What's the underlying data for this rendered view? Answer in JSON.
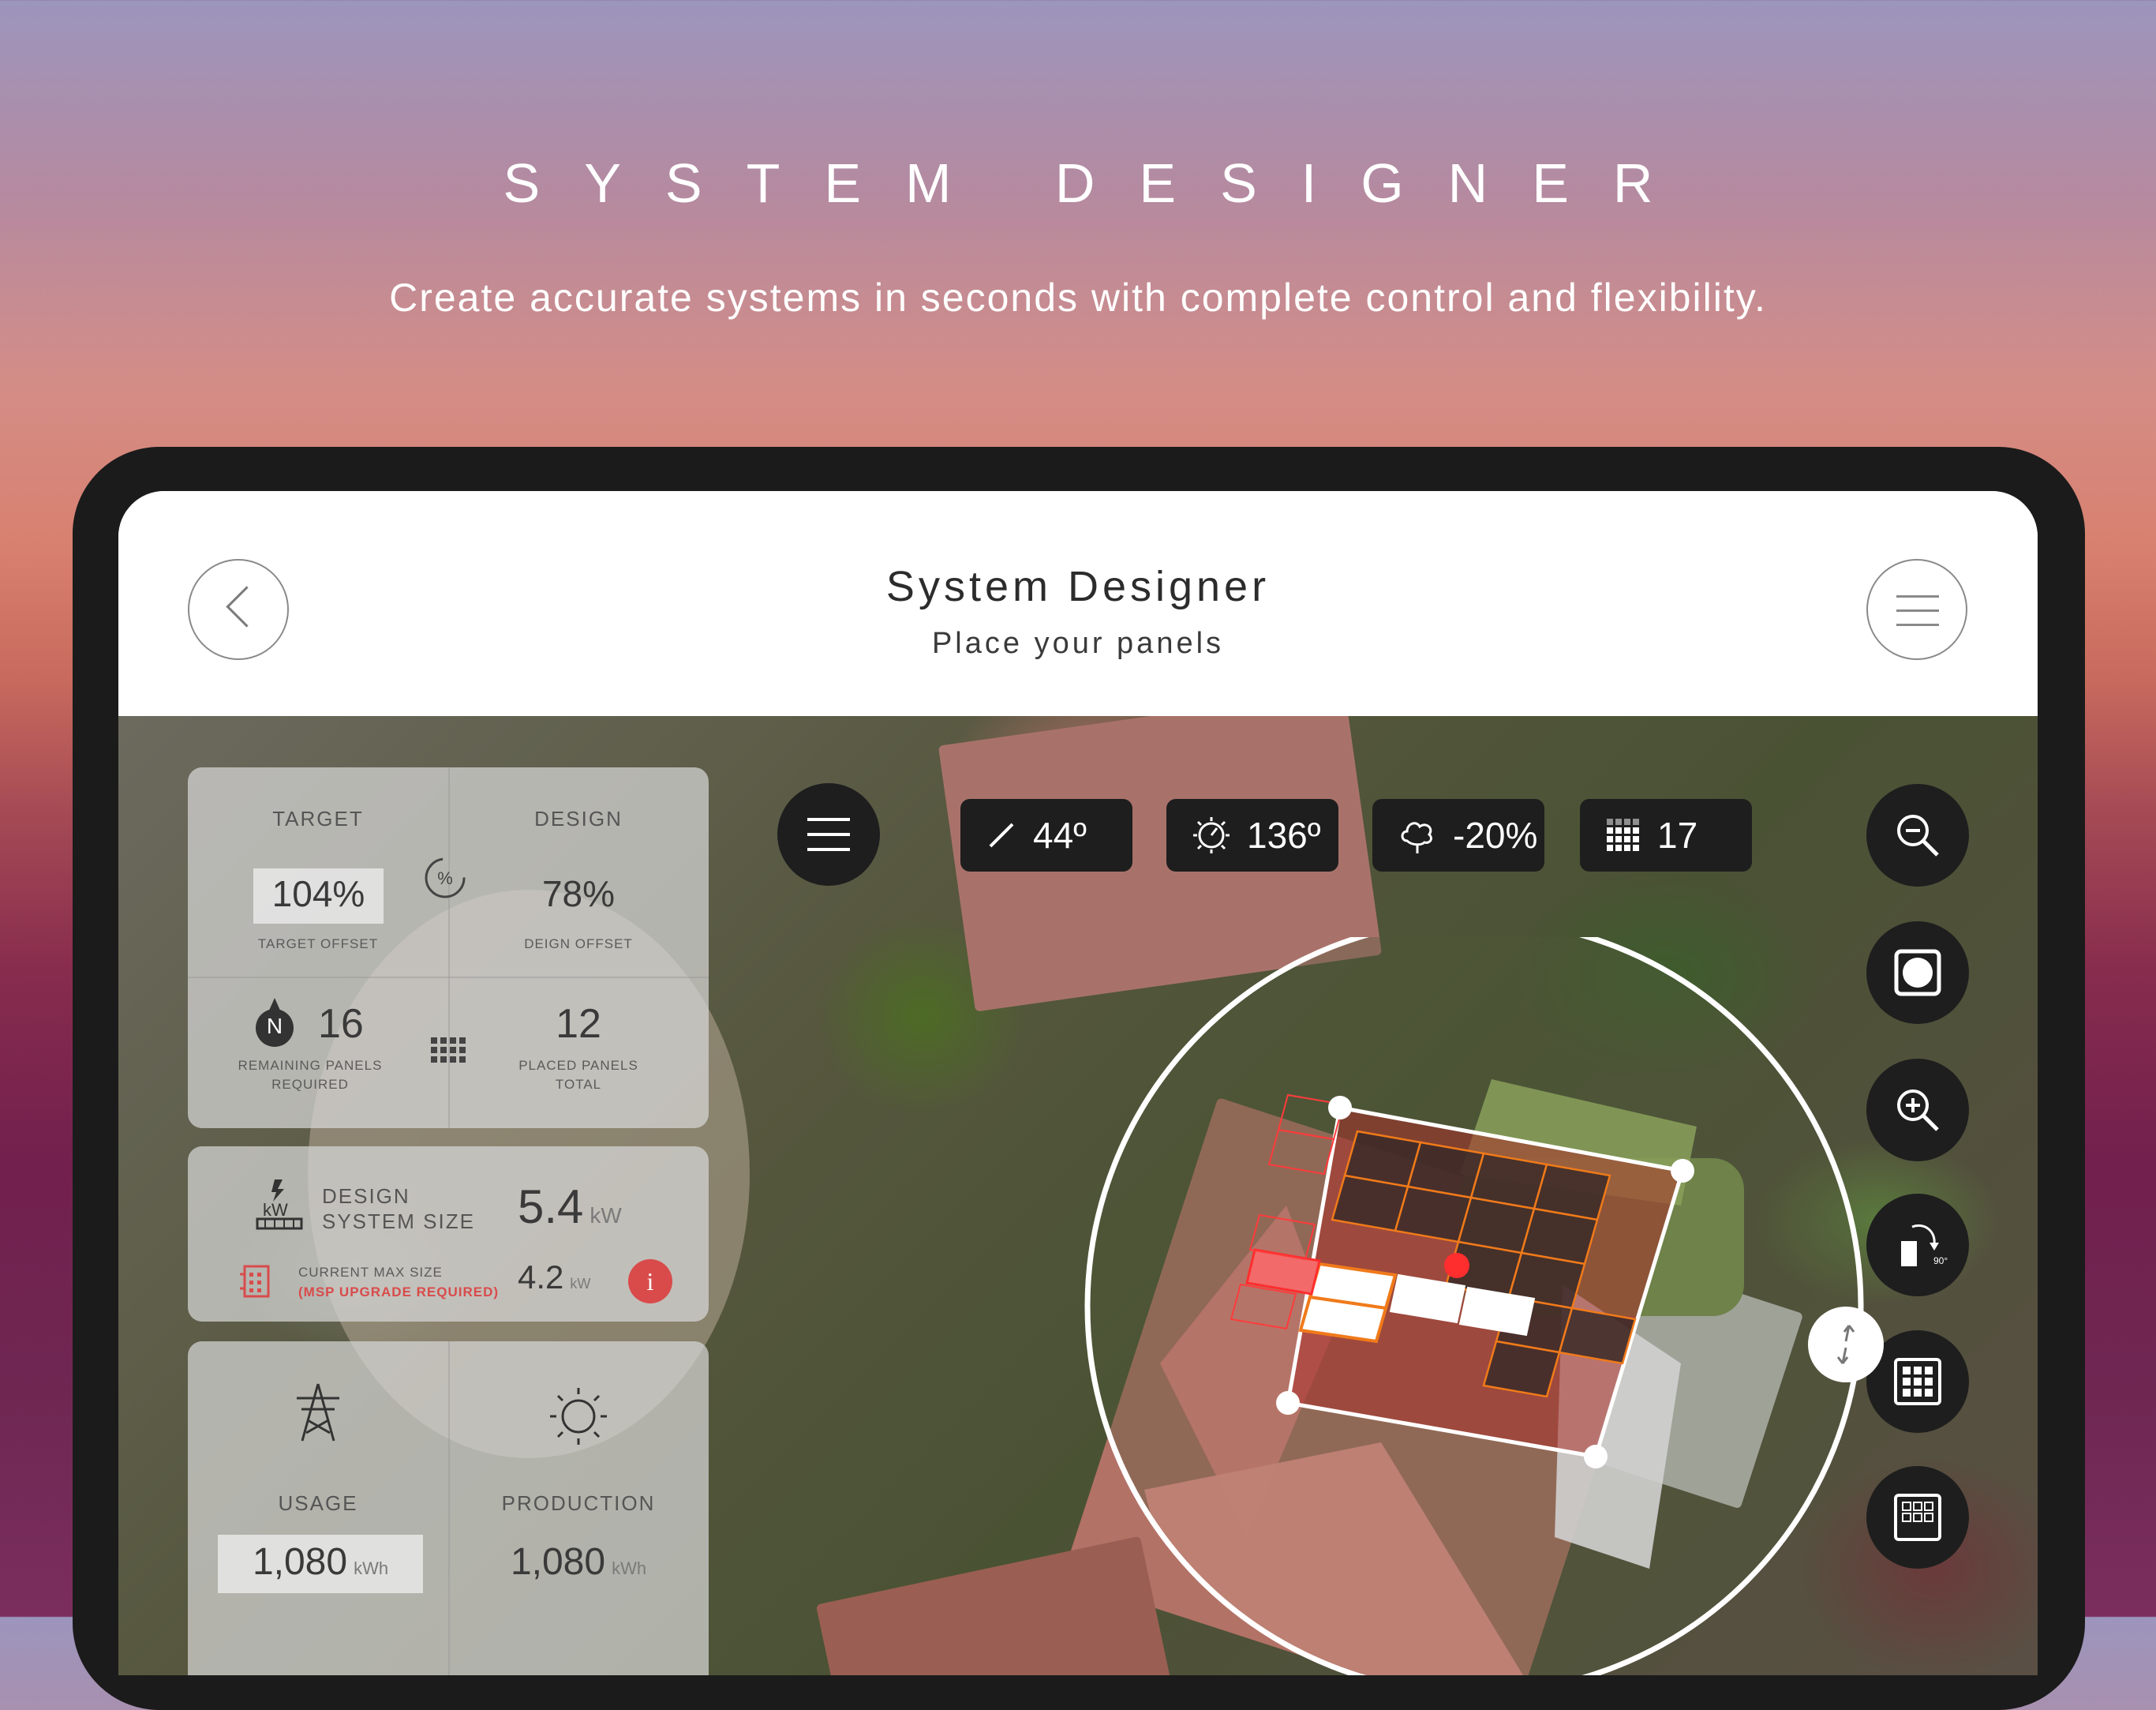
{
  "marketing": {
    "title": "SYSTEM DESIGNER",
    "subtitle": "Create accurate systems in seconds with complete control and flexibility."
  },
  "appbar": {
    "title": "System Designer",
    "subtitle": "Place your panels",
    "back_icon": "chevron-left-icon",
    "menu_icon": "hamburger-menu-icon"
  },
  "stats": {
    "target_label": "TARGET",
    "design_label": "DESIGN",
    "target_offset_value": "104%",
    "target_offset_caption": "TARGET OFFSET",
    "design_offset_value": "78%",
    "design_offset_caption": "DEIGN OFFSET",
    "remaining_value": "16",
    "remaining_caption_1": "REMAINING PANELS",
    "remaining_caption_2": "REQUIRED",
    "placed_value": "12",
    "placed_caption_1": "PLACED PANELS",
    "placed_caption_2": "TOTAL",
    "compass_letter": "N"
  },
  "system_size": {
    "label_1": "DESIGN",
    "label_2": "SYSTEM SIZE",
    "kw_icon_text": "kW",
    "value": "5.4",
    "unit": "kW",
    "max_label": "CURRENT MAX SIZE",
    "max_warning": "(MSP UPGRADE REQUIRED)",
    "max_value": "4.2",
    "max_unit": "kW",
    "info_glyph": "i"
  },
  "energy": {
    "usage_label": "USAGE",
    "production_label": "PRODUCTION",
    "usage_value": "1,080",
    "usage_unit": "kWh",
    "production_value": "1,080",
    "production_unit": "kWh"
  },
  "toolbar": {
    "pitch_value": "44º",
    "azimuth_value": "136º",
    "shading_value": "-20%",
    "panel_count_value": "17"
  },
  "side_tools": {
    "zoom_out": "zoom-out-icon",
    "capture": "capture-icon",
    "zoom_in": "zoom-in-icon",
    "rotate": "rotate-90-icon",
    "rotate_badge": "90°",
    "grid": "panel-grid-icon"
  },
  "colors": {
    "accent_orange": "#f07a1a",
    "selection_red": "#e23b3b",
    "pill_bg": "#1e1e1e"
  }
}
